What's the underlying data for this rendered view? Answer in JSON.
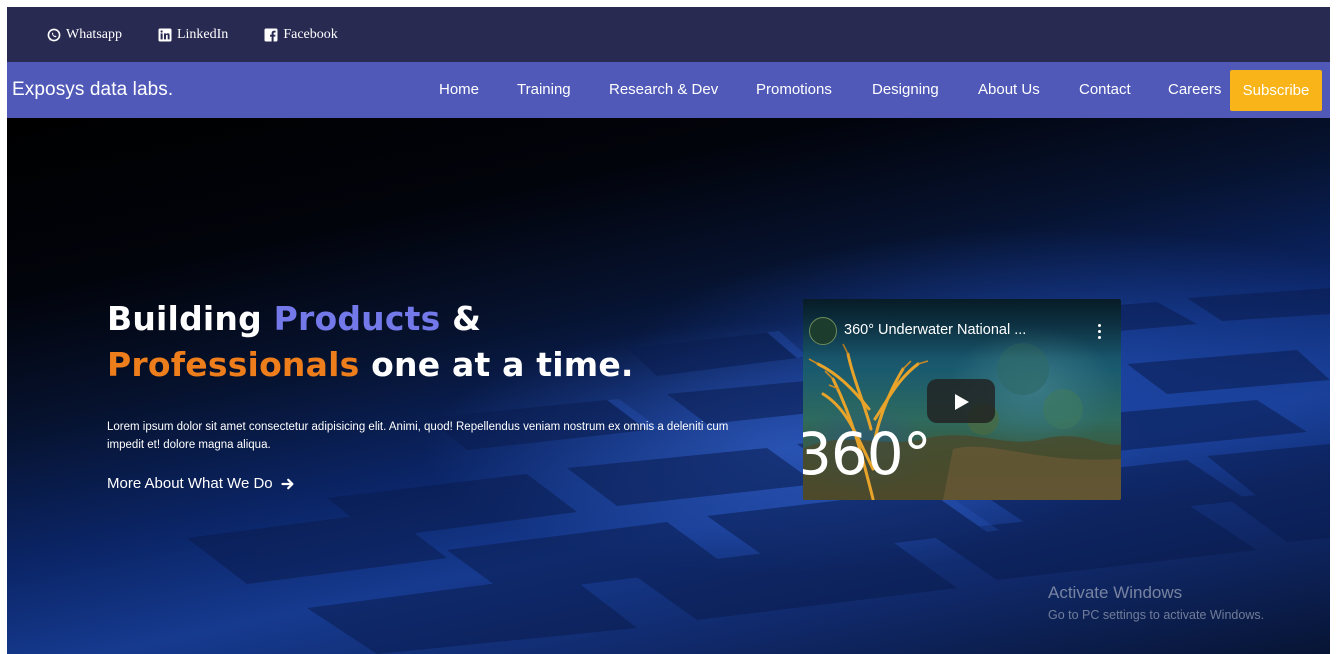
{
  "topbar": {
    "links": [
      {
        "label": "Whatsapp",
        "icon": "whatsapp-icon"
      },
      {
        "label": "LinkedIn",
        "icon": "linkedin-icon"
      },
      {
        "label": "Facebook",
        "icon": "facebook-icon"
      }
    ]
  },
  "navbar": {
    "brand": "Exposys data labs.",
    "links": [
      "Home",
      "Training",
      "Research & Dev",
      "Promotions",
      "Designing",
      "About Us",
      "Contact",
      "Careers"
    ],
    "subscribe": "Subscribe"
  },
  "hero": {
    "title_word_1": "Building",
    "title_word_2": "Products",
    "title_word_3": "&",
    "title_word_4": "Professionals",
    "title_word_5": "one at a time.",
    "description": "Lorem ipsum dolor sit amet consectetur adipisicing elit. Animi, quod! Repellendus veniam nostrum ex omnis a deleniti cum impedit et! dolore magna aliqua.",
    "link_label": "More About What We Do"
  },
  "video": {
    "title": "360° Underwater National ...",
    "overlay_text": "360°"
  },
  "watermark": {
    "title": "Activate Windows",
    "subtitle": "Go to PC settings to activate Windows."
  },
  "colors": {
    "topbar_bg": "#282a52",
    "navbar_bg": "#5059b8",
    "subscribe_bg": "#f8b418",
    "accent_purple": "#7479ea",
    "accent_orange": "#ee7d1b"
  }
}
